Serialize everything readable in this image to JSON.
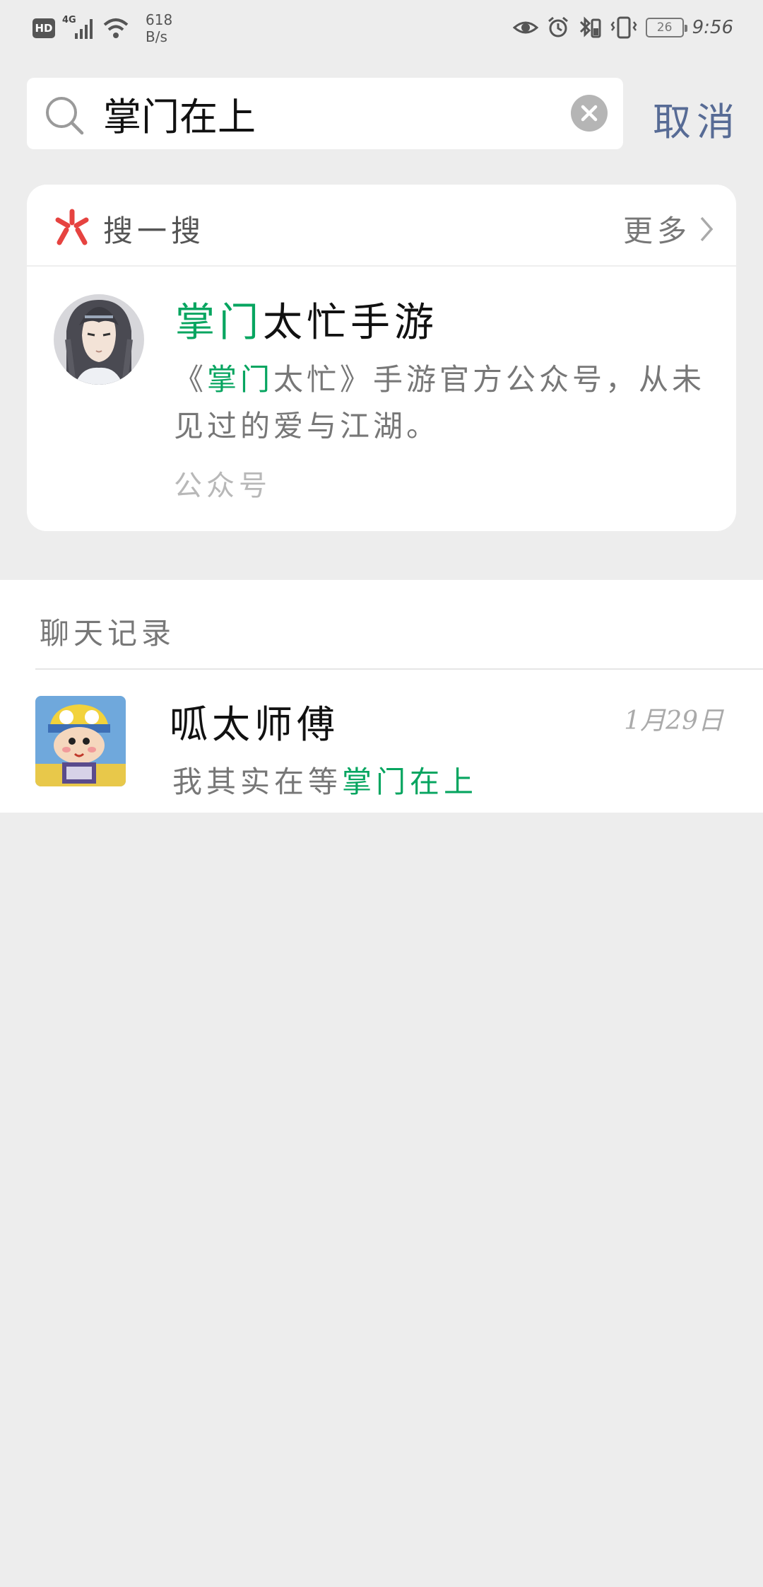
{
  "status_bar": {
    "hd": "HD",
    "network": "4G",
    "speed_value": "618",
    "speed_unit": "B/s",
    "battery": "26",
    "time": "9:56"
  },
  "search": {
    "query": "掌门在上",
    "cancel_label": "取消"
  },
  "souyisou": {
    "title": "搜一搜",
    "more_label": "更多",
    "result": {
      "title_highlight": "掌门",
      "title_rest": "太忙手游",
      "desc_pre": "《",
      "desc_highlight": "掌门",
      "desc_post": "太忙》手游官方公众号，从未见过的爱与江湖。",
      "type": "公众号"
    }
  },
  "chat_records": {
    "section_title": "聊天记录",
    "items": [
      {
        "name": "呱太师傅",
        "time": "1月29日",
        "msg_pre": "我其实在等",
        "msg_highlight": "掌门在上"
      }
    ]
  },
  "colors": {
    "highlight": "#07a560",
    "link": "#576b95",
    "background": "#ededed"
  }
}
